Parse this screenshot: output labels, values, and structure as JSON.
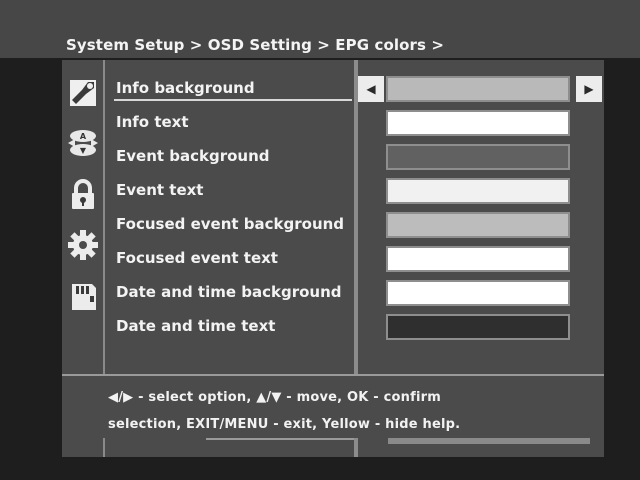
{
  "breadcrumb": "System Setup > OSD Setting > EPG colors >",
  "sidebar": {
    "icons": [
      "satellite-dish-icon",
      "language-icon",
      "lock-icon",
      "gear-icon",
      "memory-card-icon"
    ]
  },
  "options": [
    {
      "label": "Info background",
      "selected": true,
      "color": "#b9b9b9"
    },
    {
      "label": "Info text",
      "color": "#ffffff"
    },
    {
      "label": "Event background",
      "color": "#616161"
    },
    {
      "label": "Event text",
      "color": "#f1f1f1"
    },
    {
      "label": "Focused event background",
      "color": "#bcbcbc"
    },
    {
      "label": "Focused event text",
      "color": "#ffffff"
    },
    {
      "label": "Date and time background",
      "color": "#ffffff"
    },
    {
      "label": "Date and time text",
      "color": "#2f2f2f"
    }
  ],
  "help": {
    "line1": "◀/▶ - select option, ▲/▼ - move, OK - confirm",
    "line2": "selection, EXIT/MENU - exit, Yellow - hide help."
  }
}
